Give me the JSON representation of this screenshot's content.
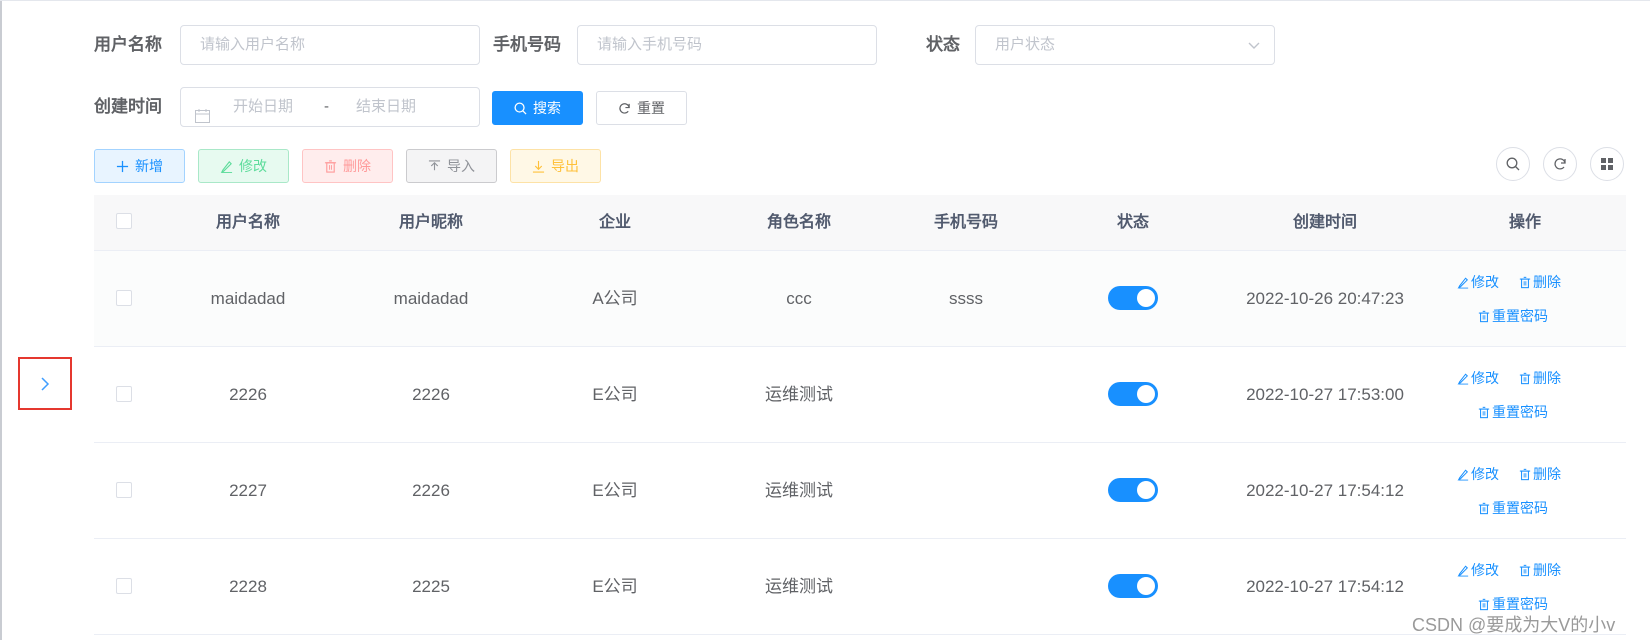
{
  "filters": {
    "username": {
      "label": "用户名称",
      "placeholder": "请输入用户名称"
    },
    "phone": {
      "label": "手机号码",
      "placeholder": "请输入手机号码"
    },
    "status": {
      "label": "状态",
      "placeholder": "用户状态"
    },
    "created": {
      "label": "创建时间",
      "start_placeholder": "开始日期",
      "separator": "-",
      "end_placeholder": "结束日期"
    },
    "search_label": "搜索",
    "reset_label": "重置"
  },
  "toolbar": {
    "add_label": "新增",
    "edit_label": "修改",
    "delete_label": "删除",
    "import_label": "导入",
    "export_label": "导出"
  },
  "table": {
    "columns": [
      "用户名称",
      "用户昵称",
      "企业",
      "角色名称",
      "手机号码",
      "状态",
      "创建时间",
      "操作"
    ],
    "rows": [
      {
        "username": "maidadad",
        "nickname": "maidadad",
        "company": "A公司",
        "role": "ccc",
        "phone": "ssss",
        "status": true,
        "created": "2022-10-26 20:47:23"
      },
      {
        "username": "2226",
        "nickname": "2226",
        "company": "E公司",
        "role": "运维测试",
        "phone": "",
        "status": true,
        "created": "2022-10-27 17:53:00"
      },
      {
        "username": "2227",
        "nickname": "2226",
        "company": "E公司",
        "role": "运维测试",
        "phone": "",
        "status": true,
        "created": "2022-10-27 17:54:12"
      },
      {
        "username": "2228",
        "nickname": "2225",
        "company": "E公司",
        "role": "运维测试",
        "phone": "",
        "status": true,
        "created": "2022-10-27 17:54:12"
      }
    ],
    "row_actions": {
      "edit": "修改",
      "delete": "删除",
      "reset_password": "重置密码"
    }
  },
  "watermark": "CSDN @要成为大V的小v",
  "colors": {
    "primary": "#1890ff",
    "highlight_border": "#e5382f"
  }
}
